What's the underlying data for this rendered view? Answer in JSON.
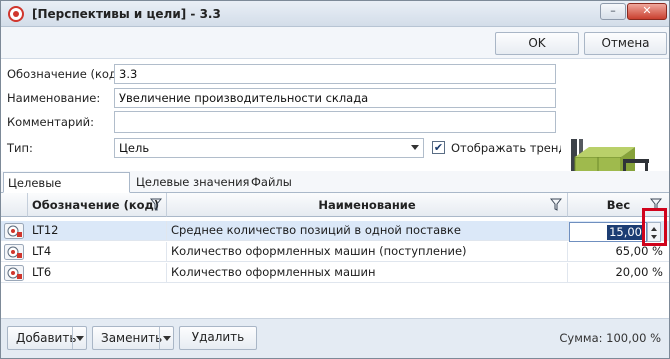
{
  "window": {
    "title": "[Перспективы и цели] - 3.3",
    "minimize_label": "–",
    "close_label": "✕"
  },
  "toolbar": {
    "ok_label": "OK",
    "cancel_label": "Отмена"
  },
  "form": {
    "code_label": "Обозначение (код):",
    "code_value": "3.3",
    "name_label": "Наименование:",
    "name_value": "Увеличение производительности склада",
    "comment_label": "Комментарий:",
    "comment_value": "",
    "type_label": "Тип:",
    "type_value": "Цель",
    "show_trend_label": "Отображать тренд:",
    "show_trend_checked": true
  },
  "tabs": [
    {
      "label": "Целевые показатели",
      "active": true
    },
    {
      "label": "Целевые значения",
      "active": false
    },
    {
      "label": "Файлы",
      "active": false
    }
  ],
  "grid": {
    "columns": {
      "code": "Обозначение (код)",
      "name": "Наименование",
      "weight": "Вес"
    },
    "rows": [
      {
        "code": "LT12",
        "name": "Среднее количество позиций в одной поставке",
        "weight": "15,00",
        "selected": true
      },
      {
        "code": "LT4",
        "name": "Количество оформленных машин (поступление)",
        "weight": "65,00 %",
        "selected": false
      },
      {
        "code": "LT6",
        "name": "Количество оформленных машин",
        "weight": "20,00 %",
        "selected": false
      }
    ],
    "sum_text": "Сумма: 100,00 %"
  },
  "bottom_toolbar": {
    "add_label": "Добавить",
    "replace_label": "Заменить",
    "delete_label": "Удалить"
  }
}
